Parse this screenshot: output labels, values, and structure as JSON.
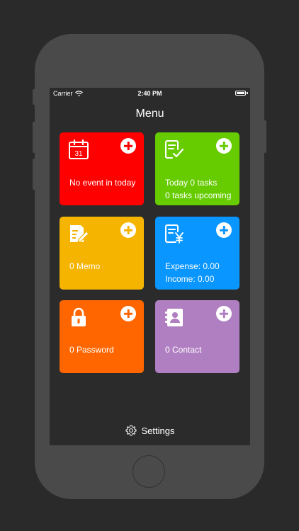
{
  "status_bar": {
    "carrier": "Carrier",
    "time": "2:40 PM",
    "wifi_icon": "wifi-icon",
    "battery_icon": "battery-icon"
  },
  "header": {
    "title": "Menu"
  },
  "tiles": [
    {
      "id": "calendar",
      "color": "#ff0000",
      "icon": "calendar-icon",
      "icon_text": "31",
      "lines": [
        "No event in today"
      ]
    },
    {
      "id": "tasks",
      "color": "#66cc00",
      "icon": "task-checklist-icon",
      "lines": [
        "Today 0 tasks",
        "0 tasks upcoming"
      ]
    },
    {
      "id": "memo",
      "color": "#f5b400",
      "icon": "memo-edit-icon",
      "lines": [
        "0 Memo"
      ]
    },
    {
      "id": "finance",
      "color": "#0a96ff",
      "icon": "finance-yen-icon",
      "lines": [
        "Expense: 0.00",
        "Income: 0.00"
      ]
    },
    {
      "id": "password",
      "color": "#ff6600",
      "icon": "lock-icon",
      "lines": [
        "0 Password"
      ]
    },
    {
      "id": "contact",
      "color": "#b07fc2",
      "icon": "contact-book-icon",
      "lines": [
        "0 Contact"
      ]
    }
  ],
  "footer": {
    "settings_label": "Settings",
    "settings_icon": "gear-icon"
  }
}
